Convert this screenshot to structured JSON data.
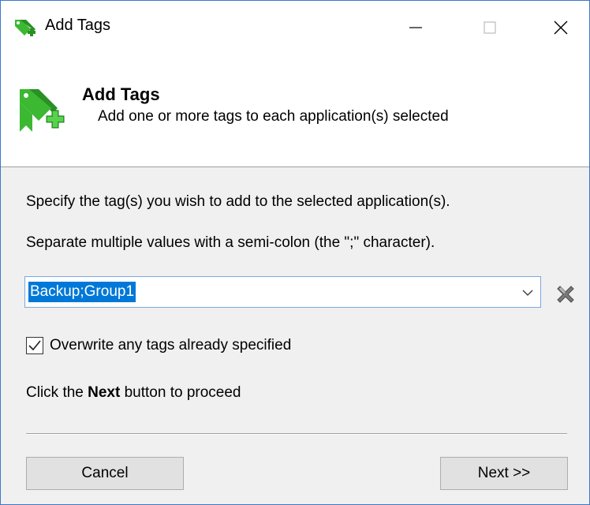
{
  "window": {
    "title": "Add Tags",
    "controls": {
      "minimize": "minimize",
      "maximize": "maximize",
      "close": "close"
    }
  },
  "header": {
    "title": "Add Tags",
    "subtitle": "Add one or more tags to each application(s) selected",
    "icon": "tag-add-icon"
  },
  "content": {
    "instruction_1": "Specify the tag(s) you wish to add to the selected application(s).",
    "instruction_2": "Separate multiple values with a semi-colon (the \";\" character).",
    "tags_combo": {
      "value": "Backup;Group1",
      "selected": true
    },
    "clear_icon": "clear-x-icon",
    "overwrite_checkbox": {
      "label": "Overwrite any tags already specified",
      "checked": true
    },
    "hint_prefix": "Click the ",
    "hint_bold": "Next",
    "hint_suffix": " button to proceed"
  },
  "buttons": {
    "cancel": "Cancel",
    "next": "Next >>"
  },
  "colors": {
    "accent": "#0078d7",
    "window_border": "#3c78c8",
    "icon_green": "#3cb832"
  }
}
